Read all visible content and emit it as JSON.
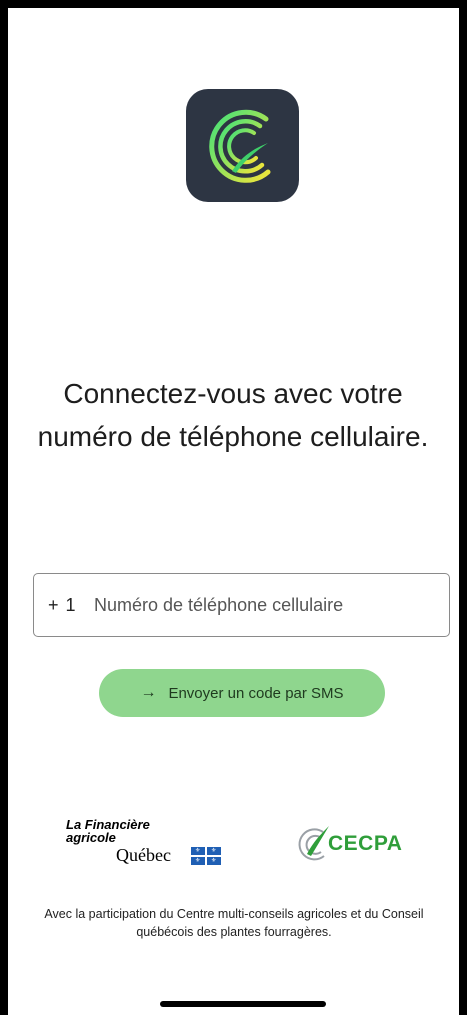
{
  "app": {
    "icon_name": "cecpa-app-icon",
    "icon_bg": "#2d3543"
  },
  "login": {
    "headline": "Connectez-vous avec votre numéro de téléphone cellulaire.",
    "country_code": "+ 1",
    "phone_placeholder": "Numéro de téléphone cellulaire",
    "phone_value": "",
    "send_button_label": "Envoyer un code par SMS",
    "send_button_icon": "arrow-right-icon",
    "accent_color": "#8fd68e"
  },
  "partners": {
    "fadq_line1": "La Financière",
    "fadq_line2": "agricole",
    "fadq_line3": "Québec",
    "cecpa_name": "CECPA"
  },
  "footer": {
    "text": "Avec la participation du Centre multi-conseils agricoles et du Conseil québécois des plantes fourragères."
  }
}
